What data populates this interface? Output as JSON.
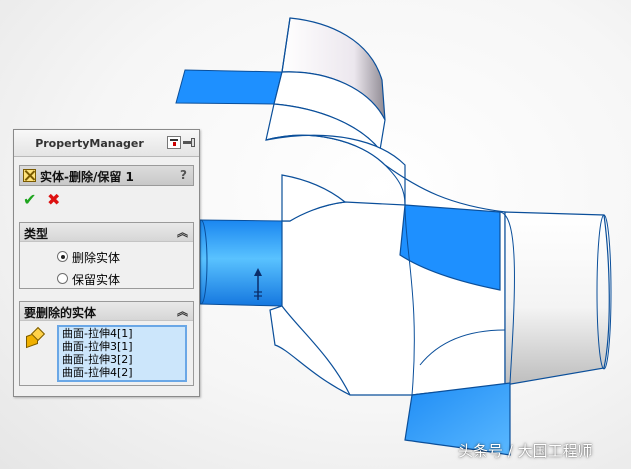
{
  "property_manager": {
    "header": "PropertyManager",
    "feature_title": "实体-删除/保留 1",
    "help": "?",
    "ok": "✔",
    "cancel": "✖",
    "type_group": {
      "title": "类型",
      "options": [
        "删除实体",
        "保留实体"
      ],
      "selected": "删除实体"
    },
    "delete_group": {
      "title": "要删除的实体",
      "items": [
        "曲面-拉伸4[1]",
        "曲面-拉伸3[1]",
        "曲面-拉伸3[2]",
        "曲面-拉伸4[2]"
      ]
    },
    "collapse_glyph": "︽"
  },
  "watermark": "头条号 / 大国工程师",
  "colors": {
    "surface_blue": "#1e90ff",
    "surface_light": "#5ab4ff",
    "panel_bg": "#f0f0f0",
    "list_selected_bg": "#cce6fb"
  }
}
